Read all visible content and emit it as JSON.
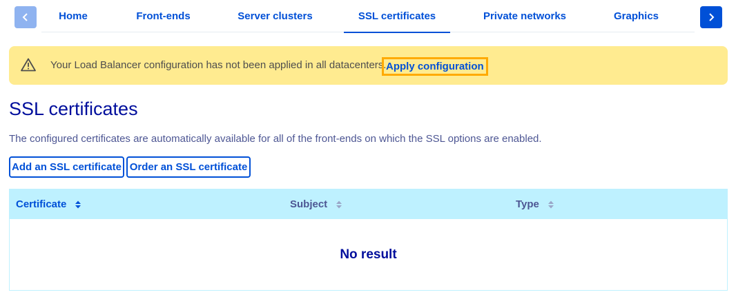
{
  "tabbar": {
    "prev_icon": "chevron-left-icon",
    "next_icon": "chevron-right-icon",
    "tabs": [
      {
        "label": "Home"
      },
      {
        "label": "Front-ends"
      },
      {
        "label": "Server clusters"
      },
      {
        "label": "SSL certificates",
        "active": true
      },
      {
        "label": "Private networks"
      },
      {
        "label": "Graphics"
      }
    ]
  },
  "banner": {
    "icon": "warning-triangle-icon",
    "message": "Your Load Balancer configuration has not been applied in all datacenters.",
    "link_label": "Apply configuration"
  },
  "section": {
    "title": "SSL certificates",
    "description": "The configured certificates are automatically available for all of the front-ends on which the SSL options are enabled.",
    "buttons": {
      "add_label": "Add an SSL certificate",
      "order_label": "Order an SSL certificate"
    }
  },
  "table": {
    "columns": [
      {
        "label": "Certificate",
        "sort_icon": "sort-icon"
      },
      {
        "label": "Subject",
        "sort_icon": "sort-icon"
      },
      {
        "label": "Type",
        "sort_icon": "sort-icon"
      }
    ],
    "empty_message": "No result"
  },
  "colors": {
    "primary": "#0050d7",
    "heading": "#000e9c",
    "banner_bg": "#ffeb90",
    "focus_outline": "#ffaa00",
    "table_header_bg": "#bef1ff"
  }
}
